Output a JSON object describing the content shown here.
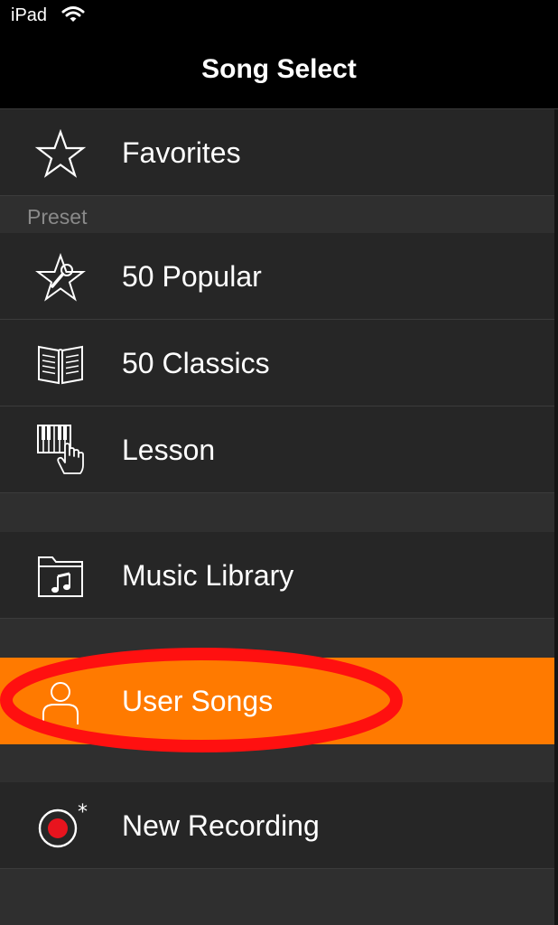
{
  "status_bar": {
    "carrier": "iPad",
    "wifi_icon": "wifi-icon"
  },
  "nav": {
    "title": "Song Select"
  },
  "favorites": {
    "label": "Favorites",
    "icon": "star-outline-icon"
  },
  "preset": {
    "header": "Preset",
    "items": [
      {
        "label": "50 Popular",
        "icon": "star-microphone-icon"
      },
      {
        "label": "50 Classics",
        "icon": "open-book-icon"
      },
      {
        "label": "Lesson",
        "icon": "piano-hand-icon"
      }
    ]
  },
  "library": {
    "label": "Music Library",
    "icon": "music-folder-icon"
  },
  "user_songs": {
    "label": "User Songs",
    "icon": "person-icon",
    "selected": true
  },
  "recording": {
    "label": "New Recording",
    "icon": "record-icon"
  },
  "colors": {
    "accent": "#ff7a00",
    "annotation": "#ff1010",
    "row_bg": "#262626",
    "section_bg": "#2f2f2f",
    "record_red": "#e8141e"
  }
}
